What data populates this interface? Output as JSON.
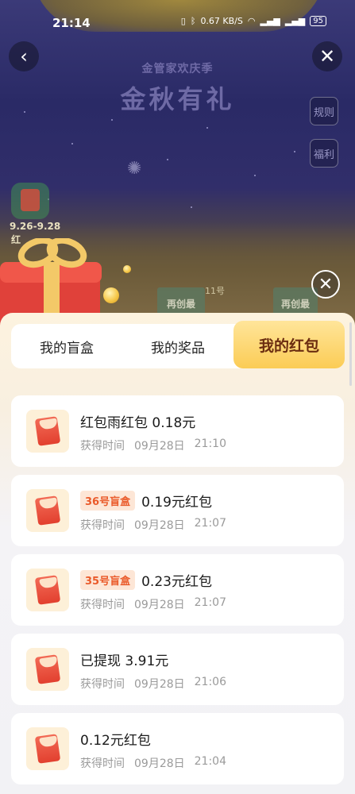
{
  "status_bar": {
    "time": "21:14",
    "speed": "0.67 KB/S",
    "battery": "95"
  },
  "header": {
    "subtitle": "金管家欢庆季",
    "title": "金秋有礼",
    "rules_label": "规则",
    "welfare_label": "福利",
    "date_range": "9.26-9.28",
    "date_sub": "红"
  },
  "scene": {
    "sign1": "再创最",
    "sign2": "再创最",
    "sign_num": "11号"
  },
  "sheet": {
    "tabs": [
      {
        "label": "我的盲盒"
      },
      {
        "label": "我的奖品"
      },
      {
        "label": "我的红包"
      }
    ],
    "active_tab": "我的红包",
    "time_label": "获得时间",
    "records": [
      {
        "tag": "",
        "title": "红包雨红包 0.18元",
        "date": "09月28日",
        "time": "21:10"
      },
      {
        "tag": "36号盲盒",
        "title": "0.19元红包",
        "date": "09月28日",
        "time": "21:07"
      },
      {
        "tag": "35号盲盒",
        "title": "0.23元红包",
        "date": "09月28日",
        "time": "21:07"
      },
      {
        "tag": "",
        "title": "已提现 3.91元",
        "date": "09月28日",
        "time": "21:06"
      },
      {
        "tag": "",
        "title": "0.12元红包",
        "date": "09月28日",
        "time": "21:04"
      }
    ]
  },
  "colors": {
    "tab_active_bg": "#fbcc55",
    "tag_text": "#ea5a2a",
    "packet_red": "#e2402f"
  }
}
